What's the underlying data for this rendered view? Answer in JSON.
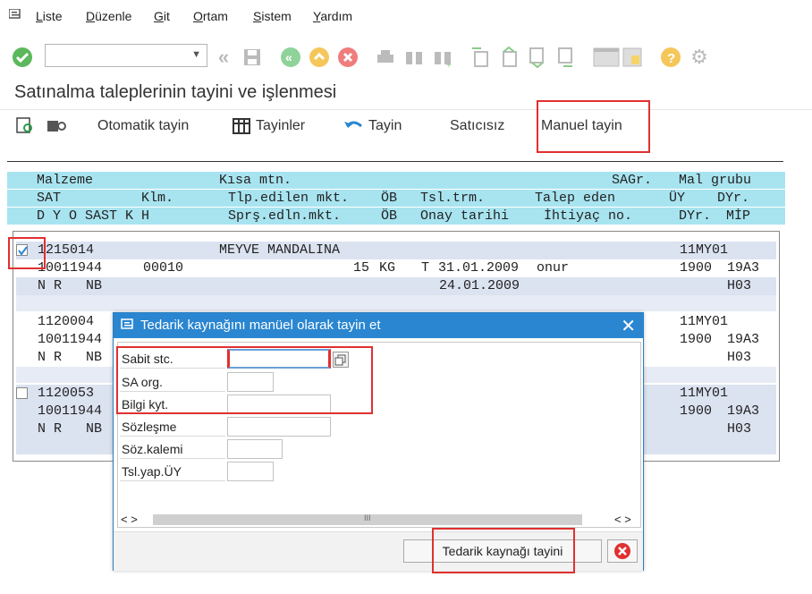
{
  "menu": [
    "Liste",
    "Düzenle",
    "Git",
    "Ortam",
    "Sistem",
    "Yardım"
  ],
  "toolbar_icons": [
    "enter-icon",
    "back-icon",
    "save-icon",
    "back-green-icon",
    "exit-icon",
    "cancel-icon",
    "print-icon",
    "find-icon",
    "find-next-icon",
    "first-page-icon",
    "prev-page-icon",
    "next-page-icon",
    "last-page-icon",
    "layout-icon",
    "new-session-icon",
    "help-icon",
    "settings-icon"
  ],
  "page_title": "Satınalma taleplerinin tayini ve işlenmesi",
  "appbar": {
    "otomatik": "Otomatik tayin",
    "tayinler": "Tayinler",
    "tayin": "Tayin",
    "saticisiz": "Satıcısız",
    "manuel": "Manuel tayin"
  },
  "header": {
    "r1": [
      "Malzeme",
      "Kısa mtn.",
      "SAGr.",
      "Mal grubu"
    ],
    "r2": [
      "SAT",
      "Klm.",
      "Tlp.edilen mkt.",
      "ÖB",
      "Tsl.trm.",
      "Talep eden",
      "ÜY",
      "DYr."
    ],
    "r3": [
      "D Y O SAST K H",
      "Sprş.edln.mkt.",
      "ÖB",
      "Onay tarihi",
      "İhtiyaç no.",
      "DYr.",
      "MİP"
    ]
  },
  "items": [
    {
      "checked": true,
      "malzeme": "1215014",
      "kisa": "MEYVE MANDALINA",
      "grp": "11MY01",
      "sat": "10011944",
      "klm": "00010",
      "mkt": "15",
      "ob": "KG",
      "t": "T",
      "trm": "31.01.2009",
      "talep": "onur",
      "uy": "1900",
      "dyr": "19A3",
      "flags": "N R   NB",
      "onay": "24.01.2009",
      "mip": "H03"
    },
    {
      "checked": false,
      "malzeme": "1120004",
      "grp": "11MY01",
      "sat": "10011944",
      "uy": "1900",
      "dyr": "19A3",
      "flags": "N R   NB",
      "mip": "H03"
    },
    {
      "checked": false,
      "malzeme": "1120053",
      "grp": "11MY01",
      "sat": "10011944",
      "uy": "1900",
      "dyr": "19A3",
      "flags": "N R   NB",
      "mip": "H03"
    }
  ],
  "dialog": {
    "title": "Tedarik kaynağını manüel olarak tayin et",
    "fields": [
      {
        "label": "Sabit stc.",
        "value": ""
      },
      {
        "label": "SA org.",
        "value": ""
      },
      {
        "label": "Bilgi kyt.",
        "value": ""
      },
      {
        "label": "Sözleşme",
        "value": ""
      },
      {
        "label": "Söz.kalemi",
        "value": ""
      },
      {
        "label": "Tsl.yap.ÜY",
        "value": ""
      }
    ],
    "scroll_left": "<  >",
    "scroll_right": "<  >",
    "scroll_mid": "III",
    "assign_button": "Tedarik kaynağı tayini"
  },
  "colors": {
    "header_band": "#a8e4f0",
    "row_band": "#dbe2f0",
    "dialog_title": "#2a86d0",
    "highlight": "#e03030"
  }
}
